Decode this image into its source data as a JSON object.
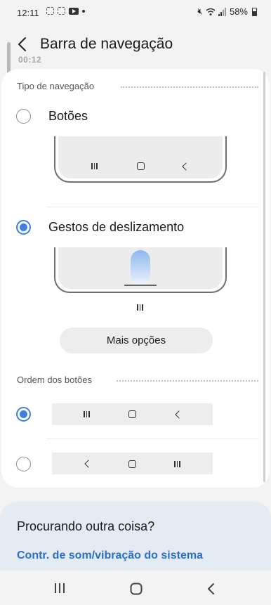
{
  "status_bar": {
    "time": "12:11",
    "battery": "58%"
  },
  "header": {
    "title": "Barra de navegação",
    "recording_time": "00:12"
  },
  "navigation_type": {
    "section_title": "Tipo de navegação",
    "options": [
      {
        "label": "Botões",
        "selected": false
      },
      {
        "label": "Gestos de deslizamento",
        "selected": true
      }
    ],
    "more_options_label": "Mais opções"
  },
  "button_order": {
    "section_title": "Ordem dos botões",
    "options": [
      {
        "order": [
          "menu",
          "home",
          "back"
        ],
        "selected": true
      },
      {
        "order": [
          "back",
          "home",
          "menu"
        ],
        "selected": false
      }
    ]
  },
  "suggestions": {
    "heading": "Procurando outra coisa?",
    "link": "Contr. de som/vibração do sistema"
  },
  "colors": {
    "accent": "#3e7ee6",
    "link": "#2a6fcb"
  }
}
